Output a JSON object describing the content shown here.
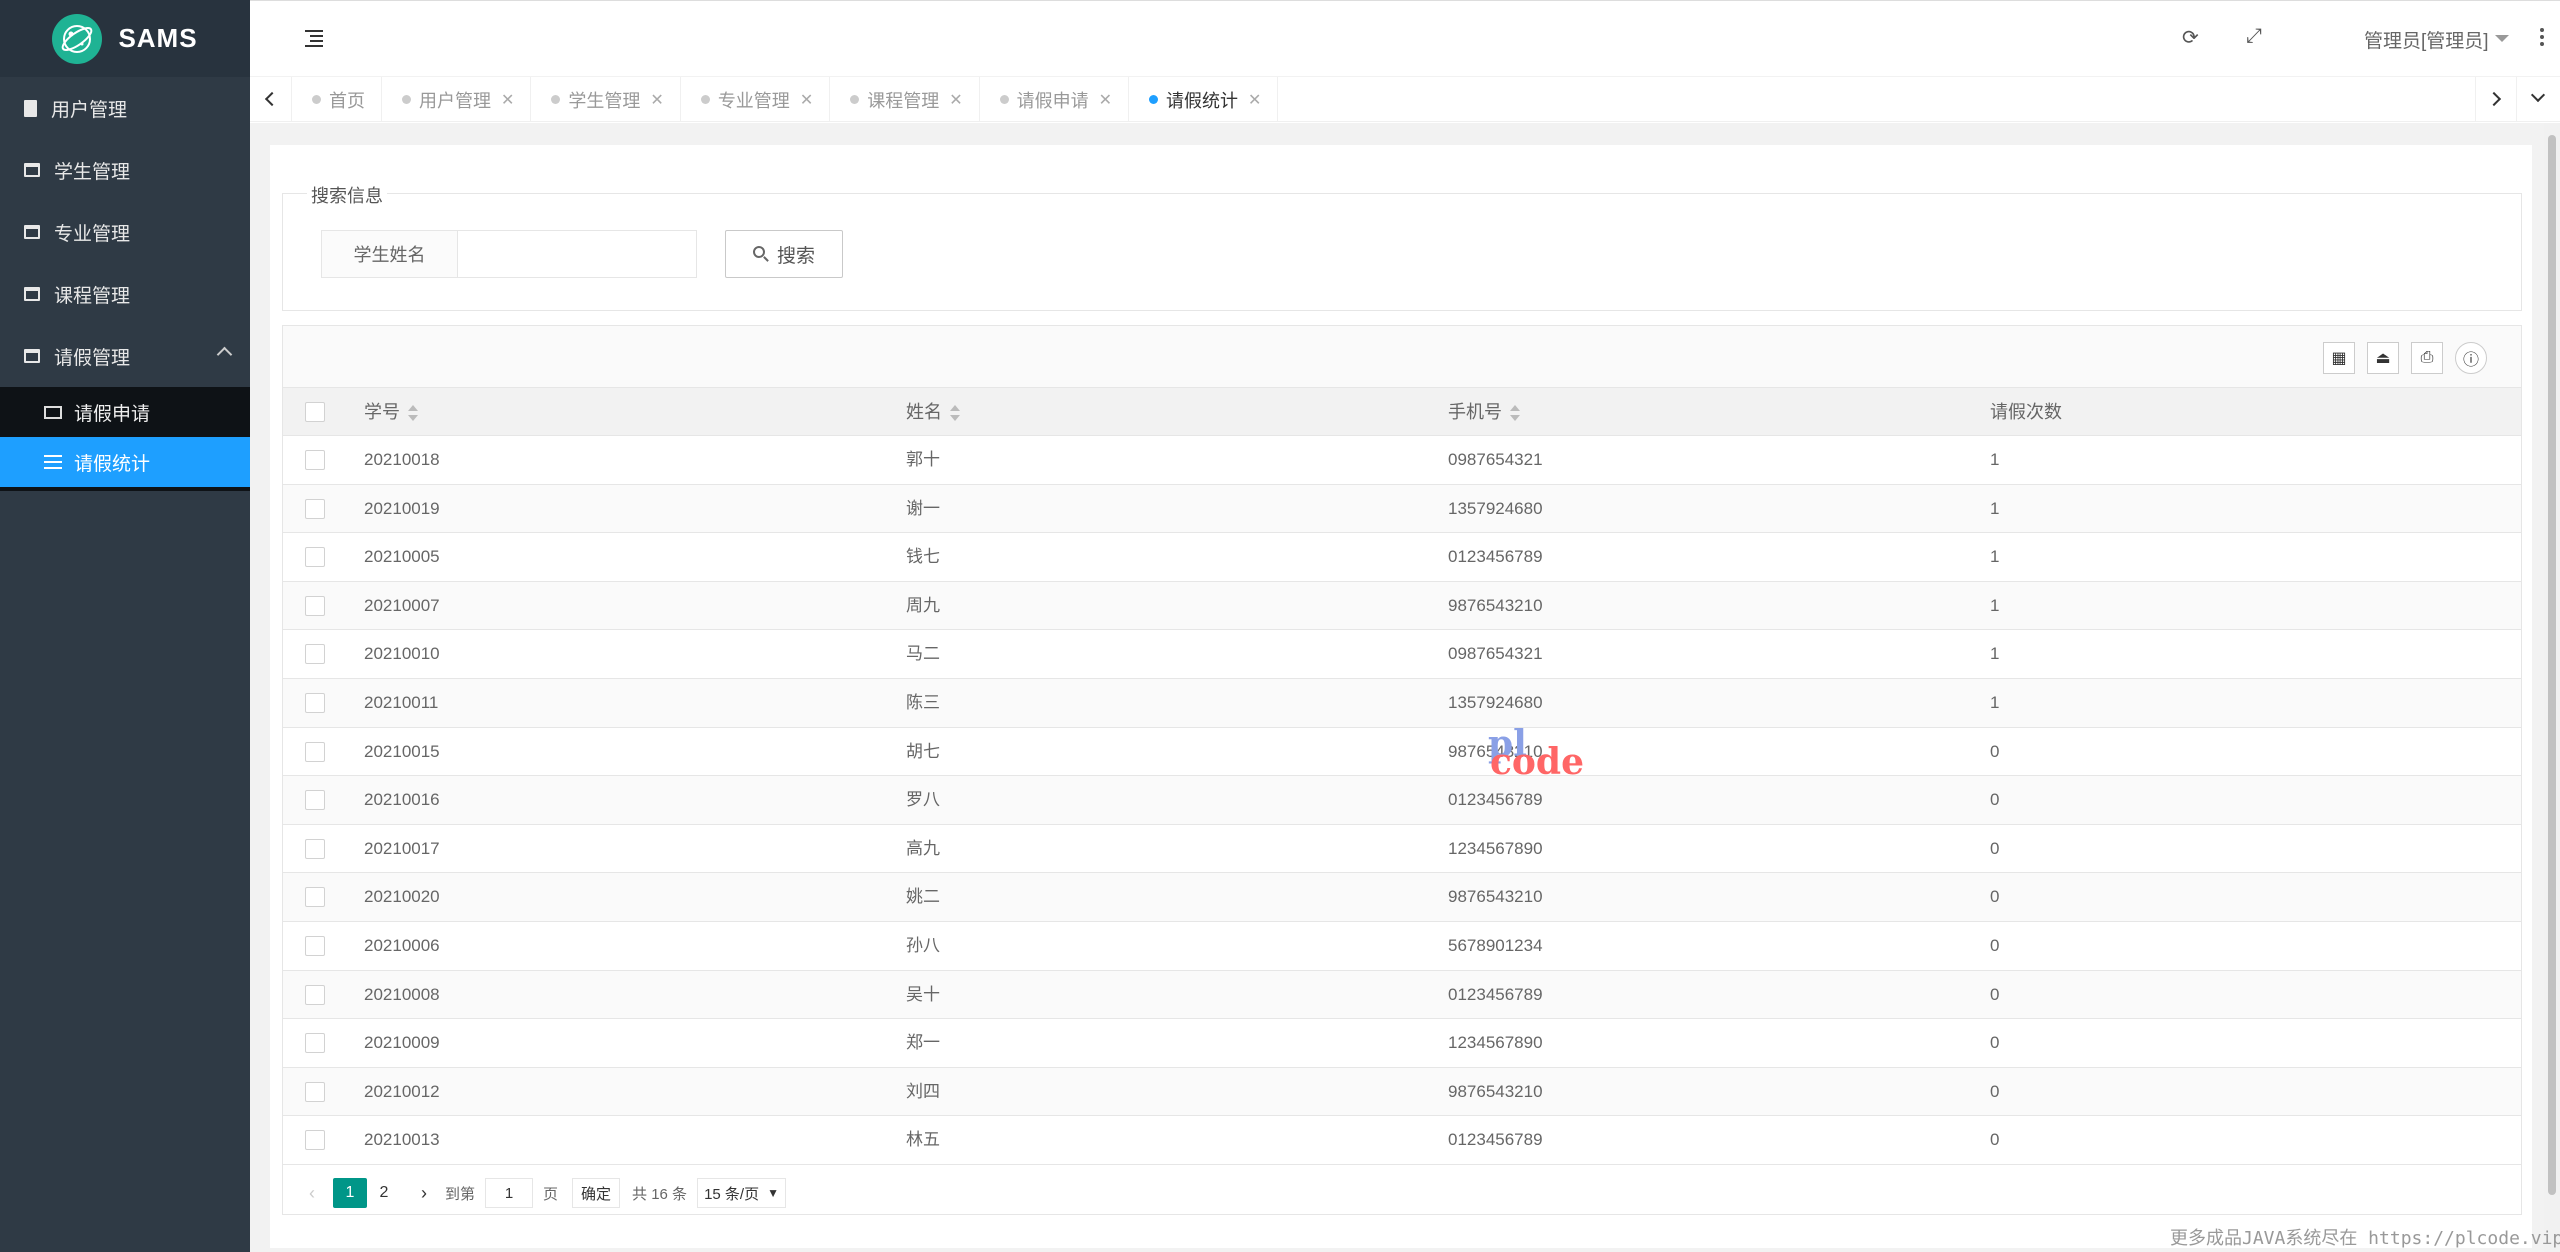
{
  "app": {
    "title": "SAMS"
  },
  "colors": {
    "sidebar": "#2f3a45",
    "active_nav": "#1e9fff",
    "pager_active": "#009688",
    "active_tab_dot": "#1e9fff"
  },
  "sidebar": {
    "items": [
      {
        "label": "用户管理",
        "icon": "file-icon"
      },
      {
        "label": "学生管理",
        "icon": "window-icon"
      },
      {
        "label": "专业管理",
        "icon": "window-icon"
      },
      {
        "label": "课程管理",
        "icon": "window-icon"
      },
      {
        "label": "请假管理",
        "icon": "window-icon",
        "expanded": true
      }
    ],
    "subitems": [
      {
        "label": "请假申请",
        "icon": "table-icon"
      },
      {
        "label": "请假统计",
        "icon": "list-icon",
        "active": true
      }
    ]
  },
  "header": {
    "user": "管理员[管理员]",
    "icons": [
      "menu-toggle-icon",
      "refresh-icon",
      "fullscreen-icon",
      "more-icon"
    ]
  },
  "tabs": [
    {
      "label": "首页",
      "closable": false
    },
    {
      "label": "用户管理",
      "closable": true
    },
    {
      "label": "学生管理",
      "closable": true
    },
    {
      "label": "专业管理",
      "closable": true
    },
    {
      "label": "课程管理",
      "closable": true
    },
    {
      "label": "请假申请",
      "closable": true
    },
    {
      "label": "请假统计",
      "closable": true,
      "active": true
    }
  ],
  "search": {
    "legend": "搜索信息",
    "label": "学生姓名",
    "value": "",
    "placeholder": "",
    "button": "搜索"
  },
  "table": {
    "columns": [
      "学号",
      "姓名",
      "手机号",
      "请假次数"
    ],
    "rows": [
      [
        "20210018",
        "郭十",
        "0987654321",
        "1"
      ],
      [
        "20210019",
        "谢一",
        "1357924680",
        "1"
      ],
      [
        "20210005",
        "钱七",
        "0123456789",
        "1"
      ],
      [
        "20210007",
        "周九",
        "9876543210",
        "1"
      ],
      [
        "20210010",
        "马二",
        "0987654321",
        "1"
      ],
      [
        "20210011",
        "陈三",
        "1357924680",
        "1"
      ],
      [
        "20210015",
        "胡七",
        "9876543210",
        "0"
      ],
      [
        "20210016",
        "罗八",
        "0123456789",
        "0"
      ],
      [
        "20210017",
        "高九",
        "1234567890",
        "0"
      ],
      [
        "20210020",
        "姚二",
        "9876543210",
        "0"
      ],
      [
        "20210006",
        "孙八",
        "5678901234",
        "0"
      ],
      [
        "20210008",
        "吴十",
        "0123456789",
        "0"
      ],
      [
        "20210009",
        "郑一",
        "1234567890",
        "0"
      ],
      [
        "20210012",
        "刘四",
        "9876543210",
        "0"
      ],
      [
        "20210013",
        "林五",
        "0123456789",
        "0"
      ]
    ]
  },
  "pager": {
    "current": "1",
    "page2": "2",
    "goto_prefix": "到第",
    "goto_value": "1",
    "goto_suffix": "页",
    "confirm": "确定",
    "total": "共 16 条",
    "page_size": "15 条/页"
  },
  "watermark": {
    "top": "pl",
    "bottom": "code"
  },
  "footer": "更多成品JAVA系统尽在 https://plcode.vip"
}
